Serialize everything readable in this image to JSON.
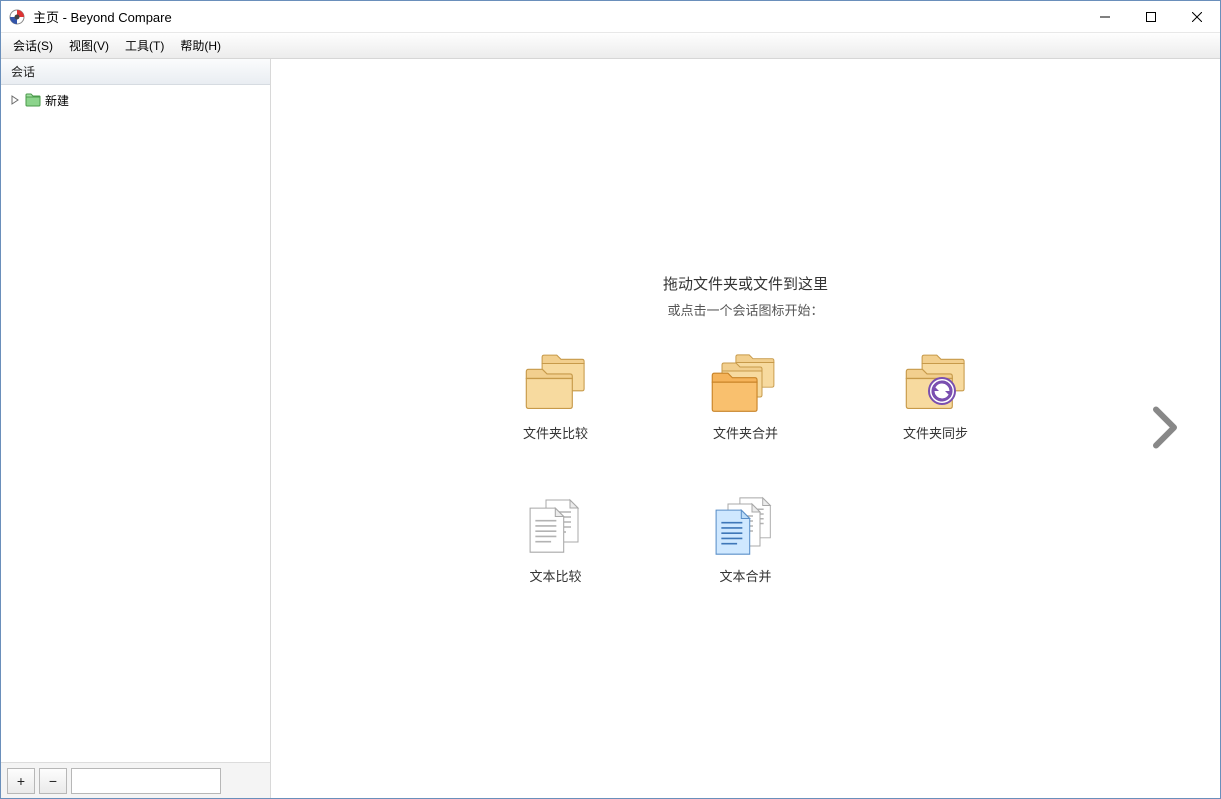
{
  "window": {
    "title": "主页 - Beyond Compare"
  },
  "menu": {
    "session": "会话(S)",
    "view": "视图(V)",
    "tools": "工具(T)",
    "help": "帮助(H)"
  },
  "sidebar": {
    "header": "会话",
    "tree": {
      "new_label": "新建"
    },
    "footer": {
      "add": "+",
      "remove": "−",
      "search_placeholder": ""
    }
  },
  "main": {
    "prompt_line1": "拖动文件夹或文件到这里",
    "prompt_line2": "或点击一个会话图标开始：",
    "sessions": [
      {
        "label": "文件夹比较"
      },
      {
        "label": "文件夹合并"
      },
      {
        "label": "文件夹同步"
      },
      {
        "label": "文本比较"
      },
      {
        "label": "文本合并"
      }
    ]
  }
}
